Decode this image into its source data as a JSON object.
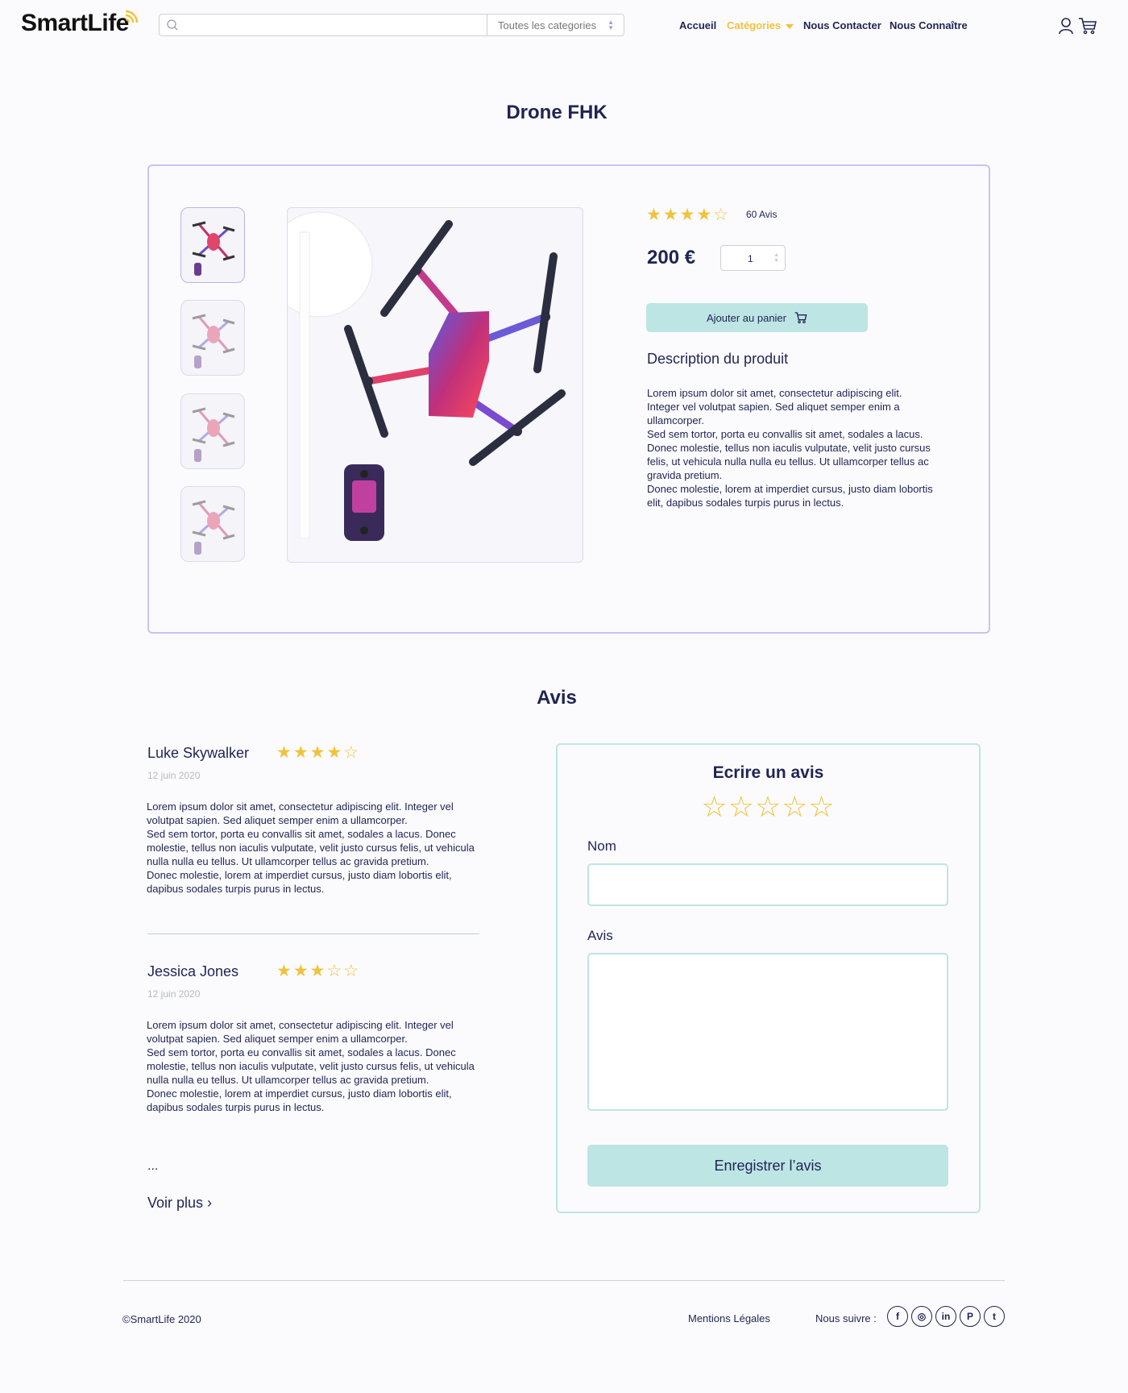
{
  "header": {
    "brand": "SmartLife",
    "search": {
      "placeholder": "",
      "category_select": "Toutes les categories"
    },
    "nav": [
      {
        "label": "Accueil"
      },
      {
        "label": "Catégories",
        "active": true
      },
      {
        "label": "Nous Contacter"
      },
      {
        "label": "Nous Connaître"
      }
    ],
    "icons": [
      "search-icon",
      "user-icon",
      "cart-icon"
    ]
  },
  "product": {
    "title": "Drone FHK",
    "rating": 4,
    "rating_max": 5,
    "stars_display": "★★★★☆",
    "reviews_count": "60 Avis",
    "price": "200 €",
    "quantity": "1",
    "add_to_cart_label": "Ajouter au panier",
    "description_title": "Description du produit",
    "description": "Lorem ipsum dolor sit amet, consectetur adipiscing elit.\nInteger vel volutpat sapien. Sed aliquet semper enim a ullamcorper.\nSed sem tortor, porta eu convallis sit amet, sodales a lacus.\nDonec molestie, tellus non iaculis vulputate, velit justo cursus felis, ut vehicula nulla nulla eu tellus. Ut ullamcorper tellus ac gravida pretium.\nDonec molestie, lorem at imperdiet cursus, justo diam lobortis elit, dapibus sodales turpis purus in lectus.",
    "thumbnail_count": 4
  },
  "reviews": {
    "section_title": "Avis",
    "items": [
      {
        "name": "Luke Skywalker",
        "rating": 4,
        "stars_display": "★★★★☆",
        "date": "12 juin 2020",
        "text": "Lorem ipsum dolor sit amet, consectetur adipiscing elit. Integer vel volutpat sapien. Sed aliquet semper enim a ullamcorper.\nSed sem tortor, porta eu convallis sit amet, sodales a lacus. Donec molestie, tellus non iaculis vulputate, velit justo cursus felis, ut vehicula nulla nulla eu tellus. Ut ullamcorper tellus ac gravida pretium.\nDonec molestie, lorem at imperdiet cursus, justo diam lobortis elit, dapibus sodales turpis purus in lectus."
      },
      {
        "name": "Jessica Jones",
        "rating": 3,
        "stars_display": "★★★☆☆",
        "date": "12 juin 2020",
        "text": "Lorem ipsum dolor sit amet, consectetur adipiscing elit. Integer vel volutpat sapien. Sed aliquet semper enim a ullamcorper.\nSed sem tortor, porta eu convallis sit amet, sodales a lacus. Donec molestie, tellus non iaculis vulputate, velit justo cursus felis, ut vehicula nulla nulla eu tellus. Ut ullamcorper tellus ac gravida pretium.\nDonec molestie, lorem at imperdiet cursus, justo diam lobortis elit, dapibus sodales turpis purus in lectus."
      }
    ],
    "ellipsis": "...",
    "see_more": "Voir plus ›"
  },
  "review_form": {
    "title": "Ecrire un avis",
    "stars_display": "☆☆☆☆☆",
    "name_label": "Nom",
    "name_value": "",
    "review_label": "Avis",
    "review_value": "",
    "submit_label": "Enregistrer l’avis"
  },
  "footer": {
    "copyright": "©SmartLife 2020",
    "legal": "Mentions Légales",
    "follow_label": "Nous suivre :",
    "social": [
      {
        "icon": "facebook-icon",
        "glyph": "f"
      },
      {
        "icon": "instagram-icon",
        "glyph": "◎"
      },
      {
        "icon": "linkedin-icon",
        "glyph": "in"
      },
      {
        "icon": "pinterest-icon",
        "glyph": "P"
      },
      {
        "icon": "twitter-icon",
        "glyph": "t"
      }
    ]
  },
  "colors": {
    "navy": "#1f2453",
    "accent_yellow": "#f1c23a",
    "mint": "#bde5e4",
    "lavender_border": "#c9c3f2"
  }
}
